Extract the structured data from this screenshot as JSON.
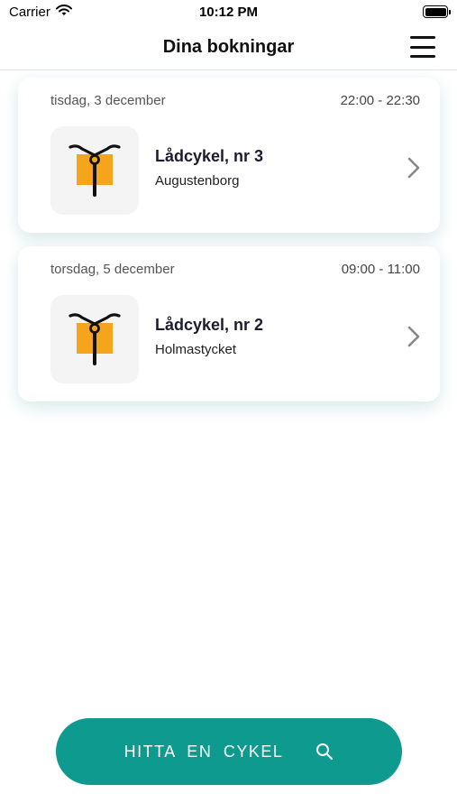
{
  "status_bar": {
    "carrier": "Carrier",
    "time": "10:12 PM"
  },
  "header": {
    "title": "Dina bokningar",
    "menu_icon": "hamburger-menu-icon"
  },
  "bookings": [
    {
      "date": "tisdag, 3 december",
      "time_range": "22:00 - 22:30",
      "bike_name": "Lådcykel, nr 3",
      "location": "Augustenborg",
      "icon": "cargo-bike-icon"
    },
    {
      "date": "torsdag, 5 december",
      "time_range": "09:00 - 11:00",
      "bike_name": "Lådcykel, nr 2",
      "location": "Holmastycket",
      "icon": "cargo-bike-icon"
    }
  ],
  "find_button": {
    "label": "HITTA EN CYKEL",
    "icon": "search-icon"
  },
  "colors": {
    "accent": "#0e9a8f",
    "bike_box": "#f5a51c",
    "thumb_background": "#f4f4f4"
  }
}
